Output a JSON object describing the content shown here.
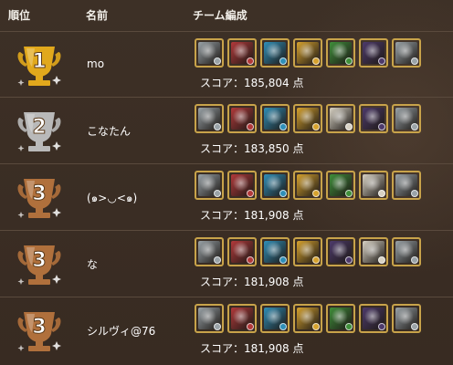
{
  "header": {
    "rank_label": "順位",
    "name_label": "名前",
    "team_label": "チーム編成"
  },
  "rows": [
    {
      "rank": "1",
      "trophy_color": "#e1a81c",
      "name": "mo",
      "score_text": "スコア：185,804 点",
      "team": [
        "silver-knight",
        "red-warrior",
        "blue-mage",
        "yellow-girl",
        "green-beast",
        "dark-witch",
        "silver-knight"
      ]
    },
    {
      "rank": "2",
      "trophy_color": "#b9b9b9",
      "name": "こなたん",
      "score_text": "スコア：183,850 点",
      "team": [
        "silver-knight",
        "red-warrior",
        "blue-mage",
        "yellow-girl",
        "white-angel",
        "dark-witch",
        "silver-knight"
      ]
    },
    {
      "rank": "3",
      "trophy_color": "#b0703c",
      "name": "(๑>◡<๑)",
      "score_text": "スコア：181,908 点",
      "team": [
        "silver-knight",
        "red-warrior",
        "blue-mage",
        "yellow-girl",
        "green-beast",
        "white-angel",
        "silver-knight"
      ]
    },
    {
      "rank": "3",
      "trophy_color": "#b0703c",
      "name": "な",
      "score_text": "スコア：181,908 点",
      "team": [
        "silver-knight",
        "red-warrior",
        "blue-mage",
        "yellow-girl",
        "dark-witch",
        "white-angel",
        "silver-knight"
      ]
    },
    {
      "rank": "3",
      "trophy_color": "#b0703c",
      "name": "シルヴィ@76",
      "score_text": "スコア：181,908 点",
      "team": [
        "silver-knight",
        "red-warrior",
        "blue-mage",
        "yellow-girl",
        "green-beast",
        "dark-witch",
        "silver-knight"
      ]
    }
  ],
  "card_colors": {
    "silver-knight": "#9aa3a8",
    "red-warrior": "#b2393a",
    "blue-mage": "#2f8fb8",
    "yellow-girl": "#d6a22e",
    "green-beast": "#3f8f3a",
    "dark-witch": "#4d3a6b",
    "white-angel": "#d8d2c4"
  }
}
